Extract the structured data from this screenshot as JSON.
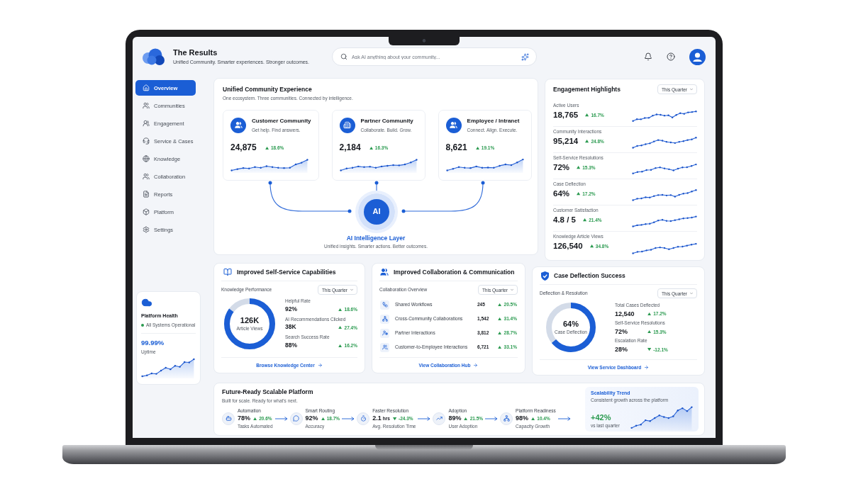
{
  "header": {
    "title": "The Results",
    "subtitle": "Unified Community. Smarter experiences. Stronger outcomes.",
    "search": {
      "placeholder": "Ask AI anything about your community..."
    }
  },
  "sidebar": {
    "items": [
      {
        "label": "Overview",
        "selected": true
      },
      {
        "label": "Communities",
        "selected": false
      },
      {
        "label": "Engagement",
        "selected": false
      },
      {
        "label": "Service & Cases",
        "selected": false
      },
      {
        "label": "Knowledge",
        "selected": false
      },
      {
        "label": "Collaboration",
        "selected": false
      },
      {
        "label": "Reports",
        "selected": false
      },
      {
        "label": "Platform",
        "selected": false
      },
      {
        "label": "Settings",
        "selected": false
      }
    ],
    "platform_health": {
      "title": "Platform Health",
      "status": "All Systems Operational",
      "uptime": "99.99%",
      "uptime_label": "Uptime"
    }
  },
  "unified_experience": {
    "title": "Unified Community Experience",
    "subtitle": "One ecosystem. Three communities. Connected by intelligence.",
    "communities": [
      {
        "name": "Customer Community",
        "tagline": "Get help. Find answers.",
        "value": "24,875",
        "delta": "18.6%",
        "increase": true
      },
      {
        "name": "Partner Community",
        "tagline": "Collaborate. Build. Grow.",
        "value": "2,184",
        "delta": "16.3%",
        "increase": true
      },
      {
        "name": "Employee / Intranet",
        "tagline": "Connect. Align. Execute.",
        "value": "8,621",
        "delta": "19.1%",
        "increase": true
      }
    ],
    "ai_layer": {
      "badge": "AI",
      "title": "AI Intelligence Layer",
      "subtitle": "Unified insights. Smarter actions. Better outcomes."
    }
  },
  "engagement_highlights": {
    "title": "Engagement Highlights",
    "period": "This Quarter",
    "metrics": [
      {
        "label": "Active Users",
        "value": "18,765",
        "delta": "16.7%",
        "increase": true
      },
      {
        "label": "Community Interactions",
        "value": "95,214",
        "delta": "24.8%",
        "increase": true
      },
      {
        "label": "Self-Service Resolutions",
        "value": "72%",
        "delta": "15.3%",
        "increase": true
      },
      {
        "label": "Case Deflection",
        "value": "64%",
        "delta": "17.2%",
        "increase": true
      },
      {
        "label": "Customer Satisfaction",
        "value": "4.8 / 5",
        "delta": "21.4%",
        "increase": true
      },
      {
        "label": "Knowledge Article Views",
        "value": "126,540",
        "delta": "34.8%",
        "increase": true
      }
    ]
  },
  "self_service": {
    "title": "Improved Self-Service Capabilities",
    "section": "Knowledge Performance",
    "period": "This Quarter",
    "ring": {
      "value": "126K",
      "label": "Article Views",
      "level": 0.85
    },
    "stats": [
      {
        "label": "Helpful Rate",
        "value": "92%",
        "delta": "18.6%",
        "increase": true
      },
      {
        "label": "AI Recommendations Clicked",
        "value": "38K",
        "delta": "27.4%",
        "increase": true
      },
      {
        "label": "Search Success Rate",
        "value": "88%",
        "delta": "16.2%",
        "increase": true
      }
    ],
    "link": "Browse Knowledge Center"
  },
  "collaboration": {
    "title": "Improved Collaboration & Communication",
    "section": "Collaboration Overview",
    "period": "This Quarter",
    "rows": [
      {
        "label": "Shared Workflows",
        "value": "245",
        "delta": "20.5%",
        "increase": true
      },
      {
        "label": "Cross-Community Collaborations",
        "value": "1,542",
        "delta": "31.4%",
        "increase": true
      },
      {
        "label": "Partner Interactions",
        "value": "3,812",
        "delta": "28.7%",
        "increase": true
      },
      {
        "label": "Customer-to-Employee Interactions",
        "value": "6,721",
        "delta": "33.1%",
        "increase": true
      }
    ],
    "link": "View Collaboration Hub"
  },
  "case_deflection": {
    "title": "Case Deflection Success",
    "section": "Deflection & Resolution",
    "period": "This Quarter",
    "ring": {
      "value": "64%",
      "label": "Case Deflection",
      "level": 0.64
    },
    "stats": [
      {
        "label": "Total Cases Deflected",
        "value": "12,540",
        "delta": "17.2%",
        "increase": true
      },
      {
        "label": "Self-Service Resolutions",
        "value": "72%",
        "delta": "15.3%",
        "increase": true
      },
      {
        "label": "Escalation Rate",
        "value": "28%",
        "delta": "-12.1%",
        "increase": false
      }
    ],
    "link": "View Service Dashboard"
  },
  "platform": {
    "title": "Future-Ready Scalable Platform",
    "subtitle": "Built for scale. Ready for what's next.",
    "steps": [
      {
        "label": "Automation",
        "value": "78%",
        "delta": "20.6%",
        "increase": true,
        "caption": "Tasks Automated"
      },
      {
        "label": "Smart Routing",
        "value": "92%",
        "delta": "18.7%",
        "increase": true,
        "caption": "Accuracy"
      },
      {
        "label": "Faster Resolution",
        "value": "2.1",
        "unit": "hrs",
        "delta": "-24.3%",
        "increase": false,
        "caption": "Avg. Resolution Time"
      },
      {
        "label": "Adoption",
        "value": "89%",
        "delta": "21.5%",
        "increase": true,
        "caption": "User Adoption"
      },
      {
        "label": "Platform Readiness",
        "value": "98%",
        "delta": "10.4%",
        "increase": true,
        "caption": "Capacity Growth"
      }
    ],
    "trend": {
      "title": "Scalability Trend",
      "subtitle": "Consistent growth across the platform",
      "value": "+42%",
      "caption": "vs last quarter"
    }
  }
}
